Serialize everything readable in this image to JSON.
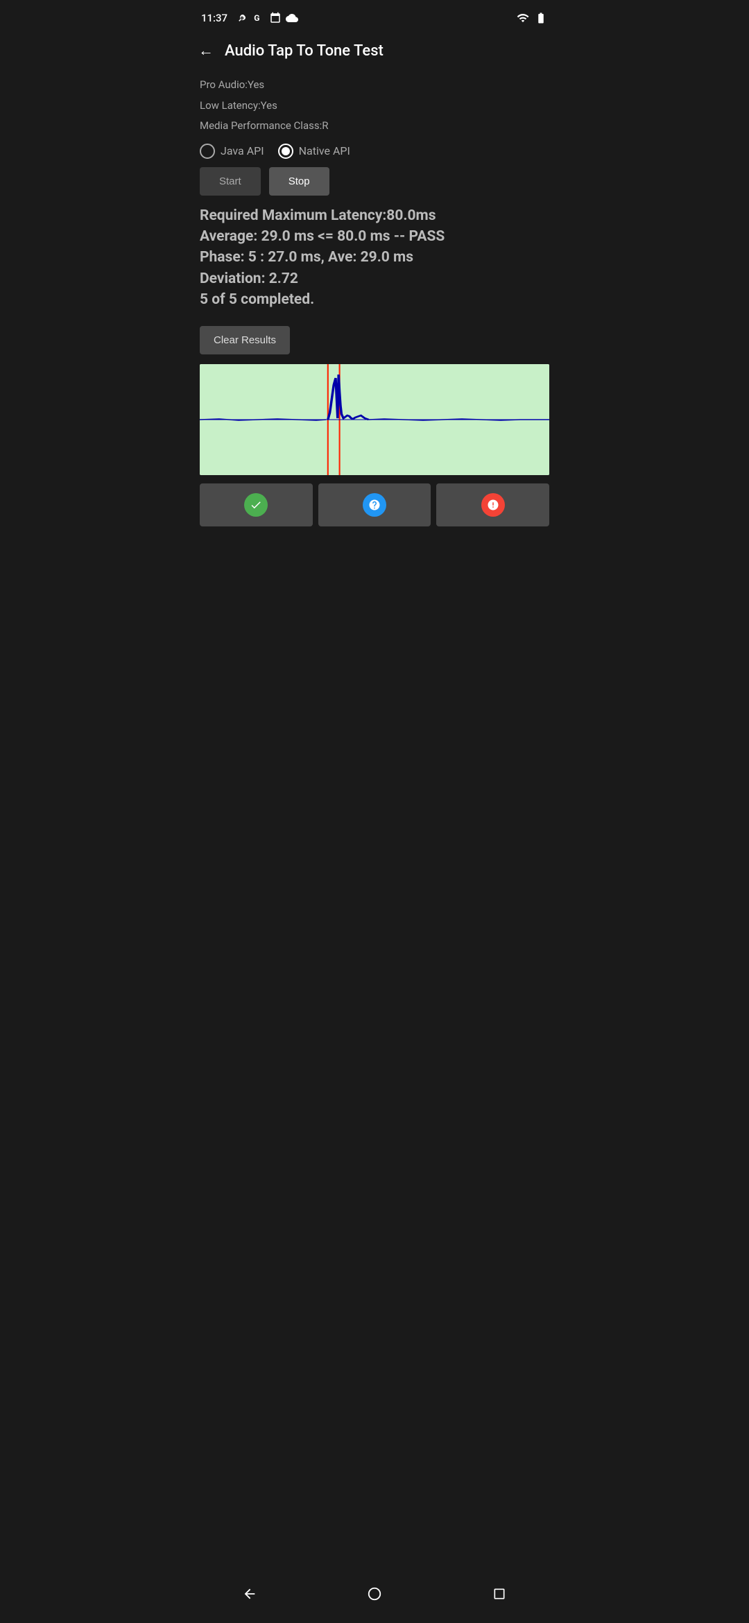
{
  "statusBar": {
    "time": "11:37",
    "icons_left": [
      "fan",
      "google",
      "calendar",
      "cloud"
    ],
    "icons_right": [
      "wifi",
      "battery"
    ]
  },
  "appBar": {
    "title": "Audio Tap To Tone Test",
    "backLabel": "←"
  },
  "deviceInfo": {
    "proAudio": "Pro Audio:Yes",
    "lowLatency": "Low Latency:Yes",
    "mediaPerformance": "Media Performance Class:R"
  },
  "radioGroup": {
    "options": [
      "Java API",
      "Native API"
    ],
    "selected": "Native API"
  },
  "buttons": {
    "start": "Start",
    "stop": "Stop"
  },
  "results": {
    "line1": "Required Maximum Latency:80.0ms",
    "line2": "Average: 29.0 ms <= 80.0 ms -- PASS",
    "line3": "Phase: 5 : 27.0 ms, Ave: 29.0 ms",
    "line4": "Deviation: 2.72",
    "line5": "5 of 5 completed.",
    "clearButton": "Clear Results"
  },
  "waveform": {
    "backgroundColor": "#c8f0c8",
    "lineColor": "#0000aa",
    "markerColor": "#ff0000"
  },
  "statusButtons": {
    "pass": "✓",
    "question": "?",
    "warning": "!"
  },
  "navBar": {
    "back": "◀",
    "home": "○",
    "recents": "□"
  }
}
